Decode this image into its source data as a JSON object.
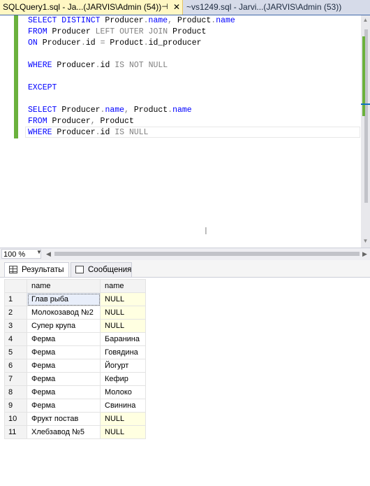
{
  "tabs": [
    {
      "title": "SQLQuery1.sql - Ja...(JARVIS\\Admin (54))",
      "pin": "⊣",
      "close": "✕",
      "active": true
    },
    {
      "title": "~vs1249.sql - Jarvi...(JARVIS\\Admin (53))",
      "active": false
    }
  ],
  "editor": {
    "lines": [
      [
        {
          "t": "SELECT DISTINCT ",
          "c": "kw"
        },
        {
          "t": "Producer",
          "c": "id"
        },
        {
          "t": ".",
          "c": "gr"
        },
        {
          "t": "name",
          "c": "kw"
        },
        {
          "t": ", ",
          "c": "gr"
        },
        {
          "t": "Product",
          "c": "id"
        },
        {
          "t": ".",
          "c": "gr"
        },
        {
          "t": "name",
          "c": "kw"
        }
      ],
      [
        {
          "t": "FROM ",
          "c": "kw"
        },
        {
          "t": "Producer ",
          "c": "id"
        },
        {
          "t": "LEFT OUTER JOIN ",
          "c": "gr"
        },
        {
          "t": "Product",
          "c": "id"
        }
      ],
      [
        {
          "t": "ON ",
          "c": "kw"
        },
        {
          "t": "Producer",
          "c": "id"
        },
        {
          "t": ".",
          "c": "gr"
        },
        {
          "t": "id ",
          "c": "id"
        },
        {
          "t": "= ",
          "c": "gr"
        },
        {
          "t": "Product",
          "c": "id"
        },
        {
          "t": ".",
          "c": "gr"
        },
        {
          "t": "id_producer",
          "c": "id"
        }
      ],
      [],
      [
        {
          "t": "WHERE ",
          "c": "kw"
        },
        {
          "t": "Producer",
          "c": "id"
        },
        {
          "t": ".",
          "c": "gr"
        },
        {
          "t": "id ",
          "c": "id"
        },
        {
          "t": "IS NOT NULL",
          "c": "gr"
        }
      ],
      [],
      [
        {
          "t": "EXCEPT",
          "c": "kw"
        }
      ],
      [],
      [
        {
          "t": "SELECT ",
          "c": "kw"
        },
        {
          "t": "Producer",
          "c": "id"
        },
        {
          "t": ".",
          "c": "gr"
        },
        {
          "t": "name",
          "c": "kw"
        },
        {
          "t": ", ",
          "c": "gr"
        },
        {
          "t": "Product",
          "c": "id"
        },
        {
          "t": ".",
          "c": "gr"
        },
        {
          "t": "name",
          "c": "kw"
        }
      ],
      [
        {
          "t": "FROM ",
          "c": "kw"
        },
        {
          "t": "Producer",
          "c": "id"
        },
        {
          "t": ", ",
          "c": "gr"
        },
        {
          "t": "Product",
          "c": "id"
        }
      ],
      [
        {
          "t": "WHERE ",
          "c": "kw"
        },
        {
          "t": "Producer",
          "c": "id"
        },
        {
          "t": ".",
          "c": "gr"
        },
        {
          "t": "id ",
          "c": "id"
        },
        {
          "t": "IS NULL",
          "c": "gr"
        }
      ]
    ]
  },
  "zoom": {
    "value": "100 %"
  },
  "results_tabs": {
    "results": "Результаты",
    "messages": "Сообщения"
  },
  "grid": {
    "columns": [
      "name",
      "name"
    ],
    "rows": [
      {
        "n": "1",
        "a": "Глав рыба",
        "b": "NULL"
      },
      {
        "n": "2",
        "a": "Молокозавод №2",
        "b": "NULL"
      },
      {
        "n": "3",
        "a": "Супер крупа",
        "b": "NULL"
      },
      {
        "n": "4",
        "a": "Ферма",
        "b": "Баранина"
      },
      {
        "n": "5",
        "a": "Ферма",
        "b": "Говядина"
      },
      {
        "n": "6",
        "a": "Ферма",
        "b": "Йогурт"
      },
      {
        "n": "7",
        "a": "Ферма",
        "b": "Кефир"
      },
      {
        "n": "8",
        "a": "Ферма",
        "b": "Молоко"
      },
      {
        "n": "9",
        "a": "Ферма",
        "b": "Свинина"
      },
      {
        "n": "10",
        "a": "Фрукт постав",
        "b": "NULL"
      },
      {
        "n": "11",
        "a": "Хлебзавод №5",
        "b": "NULL"
      }
    ]
  },
  "colors": {
    "keyword": "#0000ff",
    "operator": "#808080",
    "null_cell": "#ffffe1",
    "active_tab": "#fff7c3"
  }
}
